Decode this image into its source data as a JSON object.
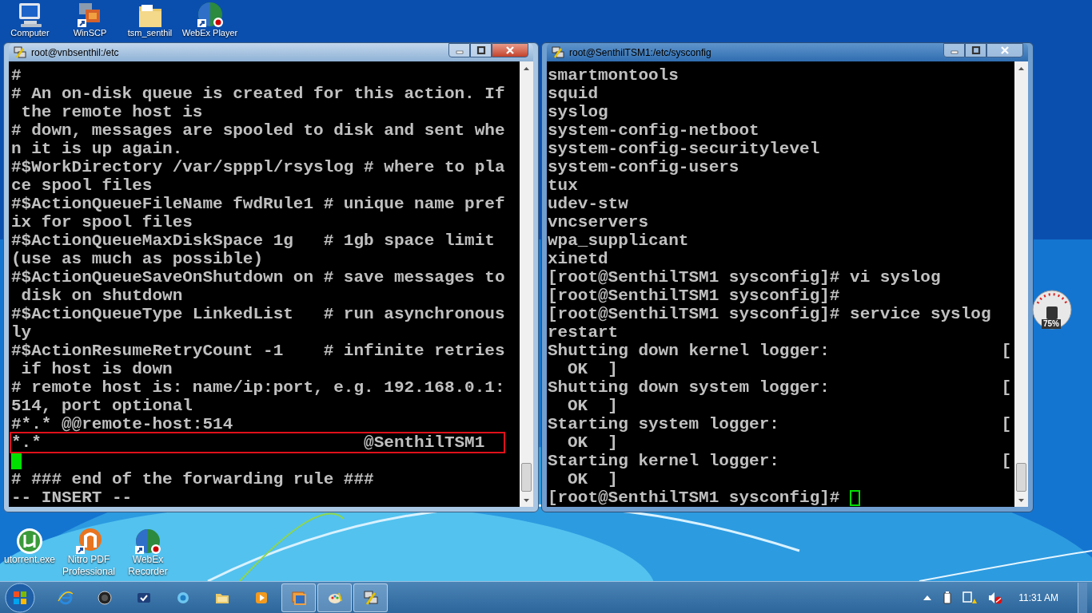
{
  "desktop_icons_top": [
    {
      "label": "Computer",
      "kind": "computer"
    },
    {
      "label": "WinSCP",
      "kind": "winscp"
    },
    {
      "label": "tsm_senthil",
      "kind": "folder"
    },
    {
      "label": "WebEx Player",
      "kind": "webex"
    }
  ],
  "desktop_icons_bottom": [
    {
      "label": "utorrent.exe",
      "kind": "utorrent"
    },
    {
      "label": "Nitro PDF Professional",
      "kind": "nitro"
    },
    {
      "label": "WebEx Recorder",
      "kind": "webex"
    }
  ],
  "left_window": {
    "title": "root@vnbsenthil:/etc",
    "active": true,
    "lines": [
      {
        "text": "#"
      },
      {
        "text": "# An on-disk queue is created for this action. If"
      },
      {
        "text": " the remote host is"
      },
      {
        "text": "# down, messages are spooled to disk and sent whe"
      },
      {
        "text": "n it is up again."
      },
      {
        "text": "#$WorkDirectory /var/spppl/rsyslog # where to pla"
      },
      {
        "text": "ce spool files"
      },
      {
        "text": "#$ActionQueueFileName fwdRule1 # unique name pref"
      },
      {
        "text": "ix for spool files"
      },
      {
        "text": "#$ActionQueueMaxDiskSpace 1g   # 1gb space limit"
      },
      {
        "text": "(use as much as possible)"
      },
      {
        "text": "#$ActionQueueSaveOnShutdown on # save messages to"
      },
      {
        "text": " disk on shutdown"
      },
      {
        "text": "#$ActionQueueType LinkedList   # run asynchronous"
      },
      {
        "text": "ly"
      },
      {
        "text": "#$ActionResumeRetryCount -1    # infinite retries"
      },
      {
        "text": " if host is down"
      },
      {
        "text": "# remote host is: name/ip:port, e.g. 192.168.0.1:"
      },
      {
        "text": "514, port optional"
      },
      {
        "text": "#*.* @@remote-host:514"
      },
      {
        "text": "*.*                                @SenthilTSM1",
        "highlighted": true
      },
      {
        "kind": "cursor"
      },
      {
        "text": "# ### end of the forwarding rule ###"
      },
      {
        "text": "-- INSERT --"
      }
    ]
  },
  "right_window": {
    "title": "root@SenthilTSM1:/etc/sysconfig",
    "active": false,
    "lines": [
      {
        "parts": [
          {
            "text": "smartmontools",
            "kind": "plain"
          }
        ]
      },
      {
        "parts": [
          {
            "text": "squid",
            "kind": "plain"
          }
        ]
      },
      {
        "parts": [
          {
            "text": "syslog",
            "kind": "plain"
          }
        ]
      },
      {
        "parts": [
          {
            "text": "system-config-netboot",
            "kind": "plain"
          }
        ]
      },
      {
        "parts": [
          {
            "text": "system-config-securitylevel",
            "kind": "plain"
          }
        ]
      },
      {
        "parts": [
          {
            "text": "system-config-users",
            "kind": "plain"
          }
        ]
      },
      {
        "parts": [
          {
            "text": "tux",
            "kind": "plain"
          }
        ]
      },
      {
        "parts": [
          {
            "text": "udev-stw",
            "kind": "plain"
          }
        ]
      },
      {
        "parts": [
          {
            "text": "vncservers",
            "kind": "plain"
          }
        ]
      },
      {
        "parts": [
          {
            "text": "wpa_supplicant",
            "kind": "plain"
          }
        ]
      },
      {
        "parts": [
          {
            "text": "xinetd",
            "kind": "plain"
          }
        ]
      },
      {
        "parts": [
          {
            "text": "[root@SenthilTSM1 sysconfig]# vi syslog",
            "kind": "plain"
          }
        ]
      },
      {
        "parts": [
          {
            "text": "[root@SenthilTSM1 sysconfig]#",
            "kind": "plain"
          }
        ]
      },
      {
        "parts": [
          {
            "text": "[root@SenthilTSM1 sysconfig]# service syslog",
            "kind": "plain"
          }
        ]
      },
      {
        "parts": [
          {
            "text": "restart",
            "kind": "plain"
          }
        ]
      },
      {
        "parts": [
          {
            "text": "Shutting down kernel logger:",
            "kind": "plain"
          },
          {
            "text": "[",
            "kind": "right"
          }
        ]
      },
      {
        "parts": [
          {
            "text": "OK",
            "kind": "ok"
          },
          {
            "text": "]",
            "kind": "plain"
          }
        ]
      },
      {
        "parts": [
          {
            "text": "Shutting down system logger:",
            "kind": "plain"
          },
          {
            "text": "[",
            "kind": "right"
          }
        ]
      },
      {
        "parts": [
          {
            "text": "OK",
            "kind": "ok"
          },
          {
            "text": "]",
            "kind": "plain"
          }
        ]
      },
      {
        "parts": [
          {
            "text": "Starting system logger:",
            "kind": "plain"
          },
          {
            "text": "[",
            "kind": "right"
          }
        ]
      },
      {
        "parts": [
          {
            "text": "OK",
            "kind": "ok"
          },
          {
            "text": "]",
            "kind": "plain"
          }
        ]
      },
      {
        "parts": [
          {
            "text": "Starting kernel logger:",
            "kind": "plain"
          },
          {
            "text": "[",
            "kind": "right"
          }
        ]
      },
      {
        "parts": [
          {
            "text": "OK",
            "kind": "ok"
          },
          {
            "text": "]",
            "kind": "plain"
          }
        ]
      },
      {
        "parts": [
          {
            "text": "[root@SenthilTSM1 sysconfig]#",
            "kind": "plain"
          }
        ],
        "cursor": true
      }
    ]
  },
  "gadget": {
    "reading": "75%"
  },
  "taskbar": {
    "items": [
      {
        "kind": "ie",
        "selected": false
      },
      {
        "kind": "hp",
        "selected": false
      },
      {
        "kind": "check",
        "selected": false
      },
      {
        "kind": "orb",
        "selected": false
      },
      {
        "kind": "folder",
        "selected": false
      },
      {
        "kind": "media",
        "selected": false
      },
      {
        "kind": "window",
        "selected": true
      },
      {
        "kind": "paint",
        "selected": true
      },
      {
        "kind": "putty",
        "selected": true
      }
    ],
    "clock": "11:31 AM"
  }
}
